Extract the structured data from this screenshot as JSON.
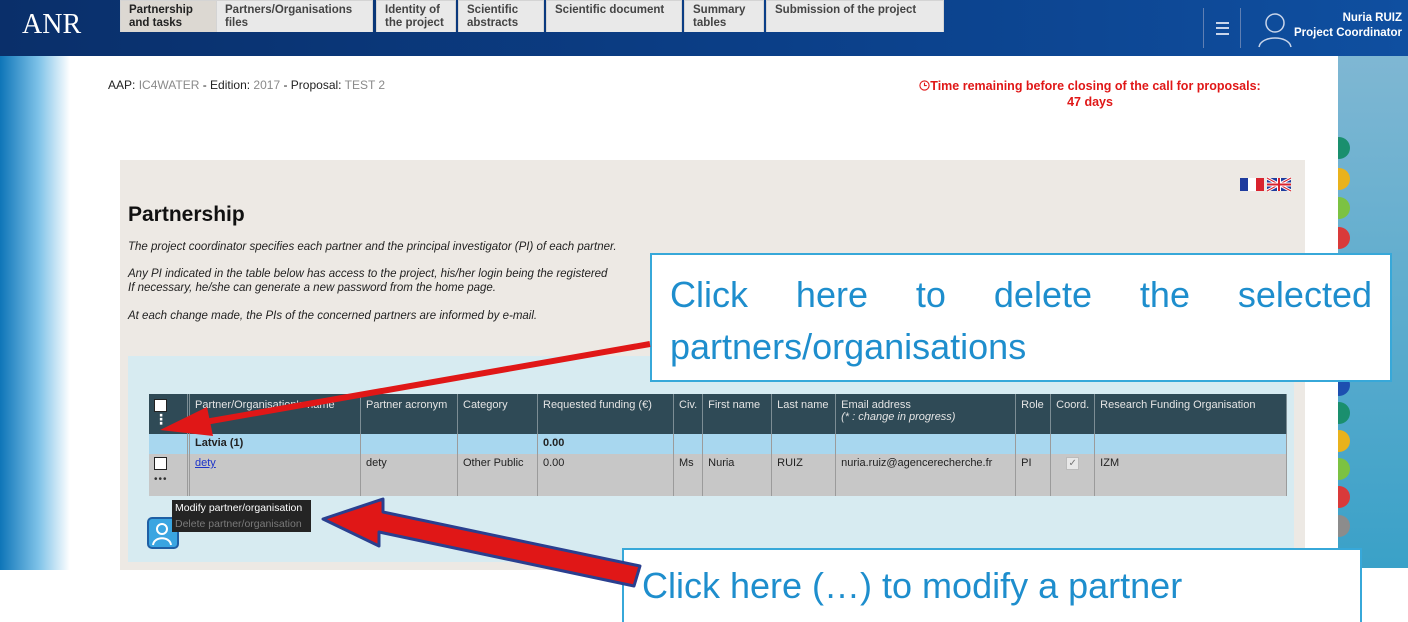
{
  "header": {
    "logo": "ANR",
    "user_name": "Nuria RUIZ",
    "user_role": "Project Coordinator"
  },
  "breadcrumb": {
    "aap_label": "AAP:",
    "aap_value": "IC4WATER",
    "sep1": " - ",
    "edition_label": "Edition:",
    "edition_value": "2017",
    "sep2": " - ",
    "proposal_label": "Proposal:",
    "proposal_value": "TEST 2"
  },
  "timer": {
    "line1": "Time remaining before closing of the call for proposals:",
    "line2": "47 days"
  },
  "tabs": [
    {
      "line1": "Partnership",
      "line2": "and tasks"
    },
    {
      "line1": "Partners/Organisations",
      "line2": "files"
    },
    {
      "line1": "Identity of",
      "line2": "the project"
    },
    {
      "line1": "Scientific",
      "line2": "abstracts"
    },
    {
      "line1": "Scientific document",
      "line2": ""
    },
    {
      "line1": "Summary",
      "line2": "tables"
    },
    {
      "line1": "Submission of the project",
      "line2": ""
    }
  ],
  "page": {
    "title": "Partnership",
    "intro": "The project coordinator specifies each partner and the principal investigator (PI) of each partner.",
    "access_line1": "Any PI indicated in the table below has access to the project, his/her login being the registered",
    "access_line2": "If necessary, he/she can generate a new password from the home page.",
    "notice": "At each change made, the PIs of the concerned partners are informed by e-mail."
  },
  "table": {
    "headers": {
      "name": "Partner/Organisation's name",
      "acronym": "Partner acronym",
      "category": "Category",
      "funding": "Requested funding (€)",
      "civ": "Civ.",
      "first": "First name",
      "last": "Last name",
      "email": "Email address",
      "email_note": "(* : change in progress)",
      "role": "Role",
      "coord": "Coord.",
      "rfo": "Research Funding Organisation"
    },
    "group": {
      "name": "Latvia (1)",
      "funding": "0.00"
    },
    "row": {
      "menu": "•••",
      "name": "dety",
      "acronym": "dety",
      "category": "Other Public",
      "funding": "0.00",
      "civ": "Ms",
      "first": "Nuria",
      "last": "RUIZ",
      "email": "nuria.ruiz@agencerecherche.fr",
      "role": "PI",
      "rfo": "IZM"
    }
  },
  "context_menu": {
    "modify": "Modify partner/organisation",
    "delete": "Delete partner/organisation"
  },
  "callouts": {
    "delete_text": "Click here to delete the selected partners/organisations",
    "modify_text": "Click here (…) to modify a partner"
  },
  "colors": {
    "header_bg": "#0b3f88",
    "timer": "#e01717",
    "table_header": "#2f4a56",
    "group_row": "#a8d7ef",
    "callout_text": "#1e8ecd",
    "arrow": "#e01717"
  }
}
